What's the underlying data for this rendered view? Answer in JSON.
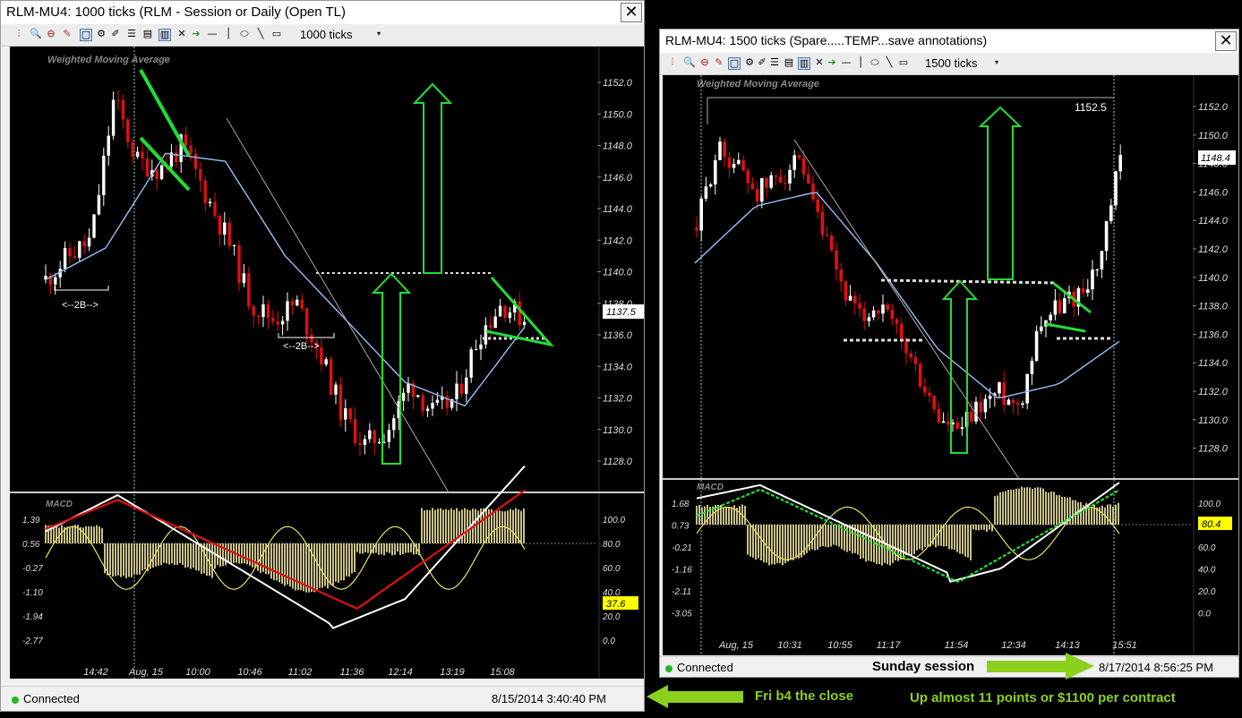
{
  "left_window": {
    "title": "RLM-MU4: 1000 ticks (RLM - Session or Daily (Open TL)",
    "close_label": "✕",
    "toolbar": {
      "ticks_label": "1000 ticks"
    },
    "status": {
      "connection": "Connected",
      "timestamp": "8/15/2014 3:40:40 PM"
    },
    "chart": {
      "indicator_label": "Weighted Moving Average",
      "price_ticks": [
        "1152.0",
        "1150.0",
        "1148.0",
        "1146.0",
        "1144.0",
        "1142.0",
        "1140.0",
        "1138.0",
        "1136.0",
        "1134.0",
        "1132.0",
        "1130.0",
        "1128.0"
      ],
      "current_price": "1137.5",
      "annotations": [
        "<--2B-->",
        "<--2B-->"
      ],
      "macd_label": "MACD",
      "macd_left_ticks": [
        "1.39",
        "0.56",
        "-0.27",
        "-1.10",
        "-1.94",
        "-2.77"
      ],
      "macd_right_ticks": [
        "100.0",
        "80.0",
        "60.0",
        "40.0",
        "20.0",
        "0.0"
      ],
      "macd_current": "37.6",
      "time_ticks": [
        "14:42",
        "Aug, 15",
        "10:00",
        "10:46",
        "11:02",
        "11:36",
        "12:14",
        "13:19",
        "15:08"
      ]
    }
  },
  "right_window": {
    "title": "RLM-MU4: 1500 ticks (Spare.....TEMP...save annotations)",
    "close_label": "✕",
    "toolbar": {
      "ticks_label": "1500 ticks"
    },
    "status": {
      "connection": "Connected",
      "timestamp": "8/17/2014 8:56:25 PM"
    },
    "chart": {
      "indicator_label": "Weighted Moving Average",
      "high_label": "1152.5",
      "price_ticks": [
        "1152.0",
        "1150.0",
        "1148.0",
        "1146.0",
        "1144.0",
        "1142.0",
        "1140.0",
        "1138.0",
        "1136.0",
        "1134.0",
        "1132.0",
        "1130.0",
        "1128.0"
      ],
      "current_price": "1148.4",
      "macd_label": "MACD",
      "macd_left_ticks": [
        "1.68",
        "0.73",
        "-0.21",
        "-1.16",
        "-2.11",
        "-3.05"
      ],
      "macd_right_ticks": [
        "100.0",
        "80.0",
        "60.0",
        "40.0",
        "20.0",
        "0.0"
      ],
      "macd_current": "80.4",
      "time_ticks": [
        "Aug, 15",
        "10:31",
        "10:55",
        "11:17",
        "11:54",
        "12:34",
        "14:13",
        "15:51"
      ]
    }
  },
  "annotations": {
    "fri_note": "Fri b4 the close",
    "sunday_note": "Sunday session",
    "gain_note": "Up almost 11 points or $1100 per contract"
  },
  "colors": {
    "accent_green": "#8cd01e",
    "up_candle": "#ffffff",
    "down_candle": "#e01010",
    "wma": "#8fb4e8",
    "price_badge": "#ffff00"
  },
  "chart_data": [
    {
      "type": "line",
      "title": "RLM-MU4: 1000 ticks",
      "ylim": [
        1127,
        1154
      ],
      "series": [
        {
          "name": "Weighted Moving Average",
          "x": [
            "14:42",
            "Aug, 15",
            "10:00",
            "10:46",
            "11:02",
            "11:36",
            "12:14",
            "13:19",
            "15:08"
          ],
          "values": [
            1139.5,
            1141.5,
            1147.5,
            1147.0,
            1141.0,
            1137.0,
            1133.0,
            1131.5,
            1136.5
          ]
        }
      ],
      "close": [
        1139.5,
        1142.0,
        1147.0,
        1146.0,
        1137.0,
        1135.0,
        1129.0,
        1131.0,
        1137.5
      ]
    },
    {
      "type": "line",
      "title": "RLM-MU4: 1500 ticks",
      "ylim": [
        1127,
        1154
      ],
      "series": [
        {
          "name": "Weighted Moving Average",
          "x": [
            "Aug, 15",
            "10:31",
            "10:55",
            "11:17",
            "11:54",
            "12:34",
            "14:13",
            "15:51"
          ],
          "values": [
            1141.0,
            1145.0,
            1146.0,
            1141.0,
            1135.0,
            1131.5,
            1132.5,
            1135.5
          ]
        }
      ],
      "close": [
        1143.5,
        1148.0,
        1145.0,
        1137.0,
        1131.0,
        1130.0,
        1138.0,
        1148.4
      ]
    }
  ]
}
